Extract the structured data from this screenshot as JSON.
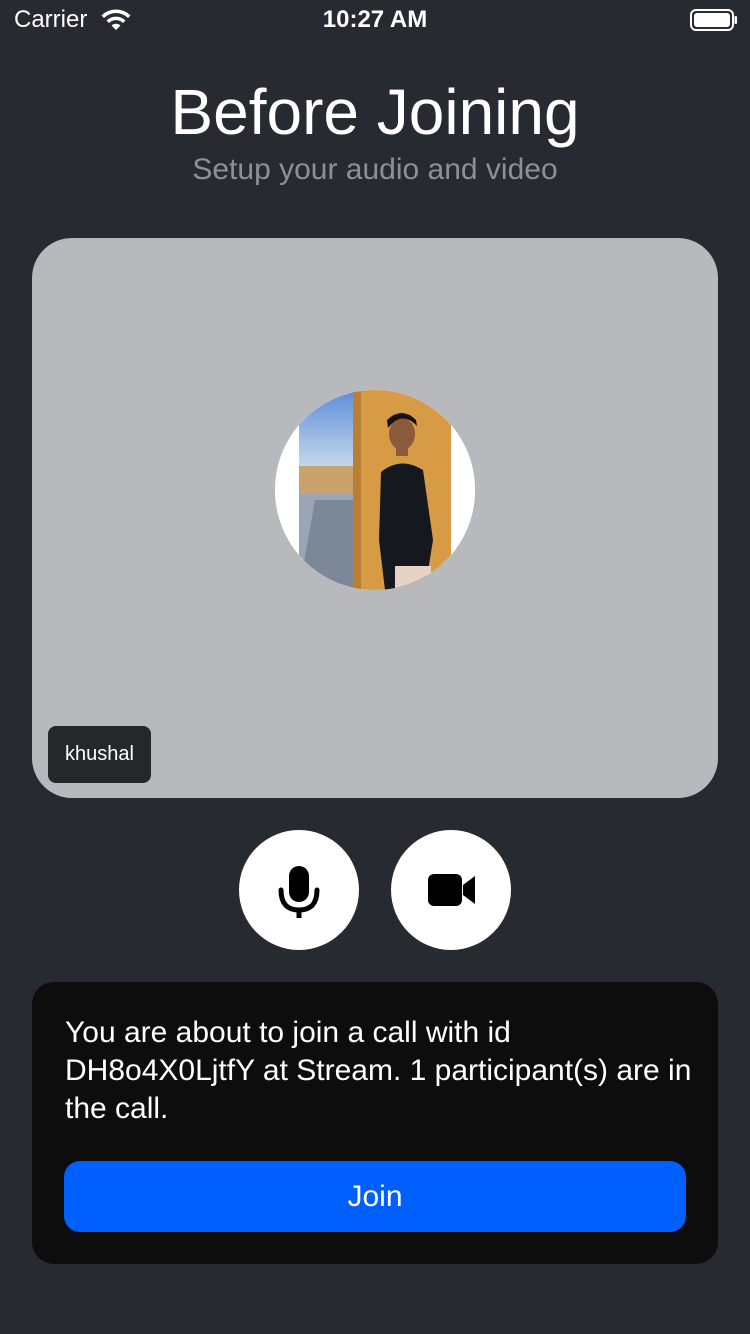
{
  "status_bar": {
    "carrier": "Carrier",
    "time": "10:27 AM",
    "wifi_icon": "wifi-icon",
    "battery_icon": "battery-icon"
  },
  "header": {
    "title": "Before Joining",
    "subtitle": "Setup your audio and video"
  },
  "preview": {
    "participant_name": "khushal",
    "avatar": "user-photo-avatar"
  },
  "controls": {
    "microphone_icon": "microphone-icon",
    "camera_icon": "video-camera-icon"
  },
  "info": {
    "message": "You are about to join a call with id DH8o4X0LjtfY at Stream. 1 participant(s) are in the call.",
    "join_label": "Join"
  },
  "colors": {
    "background": "#272a31",
    "preview_bg": "#b7b9bd",
    "card_bg": "#0d0d0e",
    "accent": "#005fff",
    "subtitle": "#8e9097"
  }
}
